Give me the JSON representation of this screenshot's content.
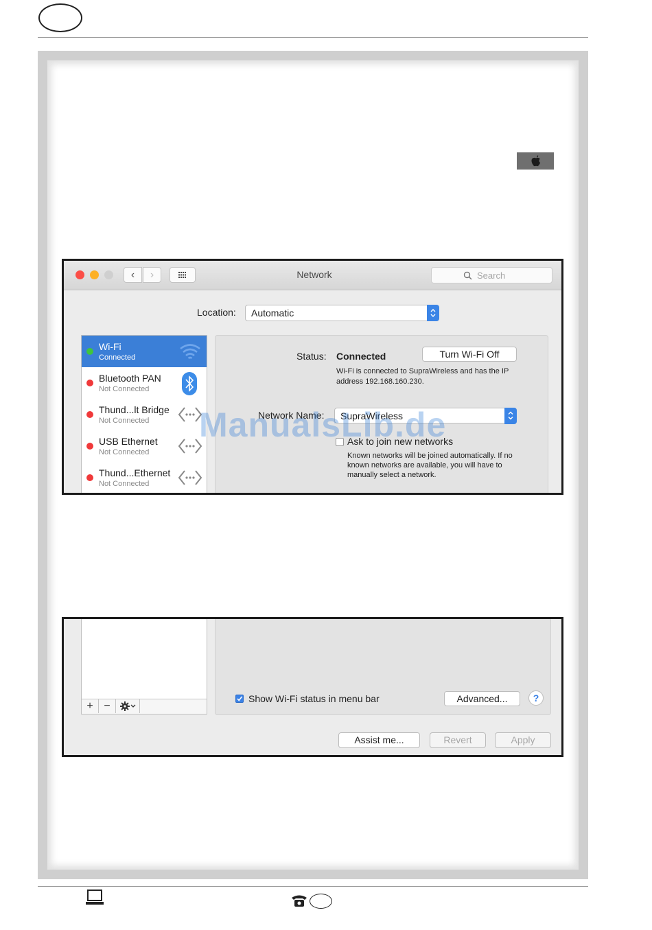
{
  "network_window": {
    "title": "Network",
    "search_placeholder": "Search",
    "location_label": "Location:",
    "location_value": "Automatic",
    "services": [
      {
        "name": "Wi-Fi",
        "status": "Connected",
        "dot": "green",
        "icon": "wifi-icon",
        "selected": true
      },
      {
        "name": "Bluetooth PAN",
        "status": "Not Connected",
        "dot": "red",
        "icon": "bluetooth-icon",
        "selected": false
      },
      {
        "name": "Thund...lt Bridge",
        "status": "Not Connected",
        "dot": "red",
        "icon": "ethernet-arrows-icon",
        "selected": false
      },
      {
        "name": "USB Ethernet",
        "status": "Not Connected",
        "dot": "red",
        "icon": "ethernet-arrows-icon",
        "selected": false
      },
      {
        "name": "Thund...Ethernet",
        "status": "Not Connected",
        "dot": "red",
        "icon": "ethernet-arrows-icon",
        "selected": false
      }
    ],
    "status_label": "Status:",
    "status_value": "Connected",
    "turn_off_label": "Turn Wi-Fi Off",
    "status_description": "Wi-Fi is connected to SupraWireless and has the IP address 192.168.160.230.",
    "network_name_label": "Network Name:",
    "network_name_value": "SupraWireless",
    "ask_join_label": "Ask to join new networks",
    "ask_join_checked": false,
    "ask_join_description": "Known networks will be joined automatically. If no known networks are available, you will have to manually select a network."
  },
  "watermark": "ManualsLib.de",
  "bottom_window": {
    "add_label": "+",
    "remove_label": "−",
    "show_status_label": "Show Wi-Fi status in menu bar",
    "show_status_checked": true,
    "advanced_label": "Advanced...",
    "help_label": "?",
    "assist_label": "Assist me...",
    "revert_label": "Revert",
    "apply_label": "Apply"
  },
  "colors": {
    "selection_blue": "#3b7fd7",
    "connected_green": "#3fc53f",
    "disconnected_red": "#f0393a",
    "close_red": "#fb4e47",
    "minimize_yellow": "#fdb024"
  }
}
